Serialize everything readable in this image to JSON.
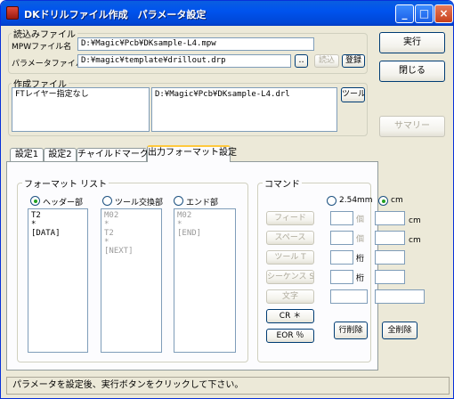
{
  "window": {
    "title": "DKドリルファイル作成　パラメータ設定",
    "controls": {
      "minimize": "_",
      "maximize": "□",
      "close": "×"
    }
  },
  "read_group": {
    "legend": "読込みファイル",
    "mpw_label": "MPWファイル名",
    "mpw_value": "D:¥Magic¥Pcb¥DKsample-L4.mpw",
    "param_label": "パラメータファイル名",
    "param_value": "D:¥magic¥template¥drillout.drp",
    "browse_label": "..",
    "load_label": "読込",
    "register_label": "登録"
  },
  "create_group": {
    "legend": "作成ファイル",
    "list_left": [
      "FTレイヤー指定なし"
    ],
    "list_right": [
      "D:¥Magic¥Pcb¥DKsample-L4.drl"
    ],
    "tool_label": "ツール"
  },
  "side_buttons": {
    "execute": "実行",
    "close": "閉じる",
    "summary": "サマリー"
  },
  "tabs": [
    {
      "label": "設定1"
    },
    {
      "label": "設定2"
    },
    {
      "label": "チャイルドマーク"
    },
    {
      "label": "出力フォーマット設定"
    }
  ],
  "format_group": {
    "legend": "フォーマット リスト",
    "radio_header": "ヘッダー部",
    "radio_tool": "ツール交換部",
    "radio_end": "エンド部",
    "list_header": [
      "T2",
      "*",
      "[DATA]"
    ],
    "list_tool": [
      "M02",
      "*",
      "T2",
      "*",
      "[NEXT]"
    ],
    "list_end": [
      "M02",
      "*",
      "[END]"
    ]
  },
  "command_group": {
    "legend": "コマンド",
    "radio_254": "2.54mm",
    "radio_cm": "cm",
    "feed": "フィード",
    "space": "スペース",
    "tool_t": "ツール T",
    "sequence": "シーケンス S",
    "char": "文字",
    "cr": "CR ＊",
    "eor": "EOR ％",
    "unit_ko": "個",
    "unit_keta": "桁",
    "unit_cm": "cm",
    "delete_line": "行削除",
    "delete_all": "全削除"
  },
  "status": {
    "message": "パラメータを設定後、実行ボタンをクリックして下さい。"
  }
}
